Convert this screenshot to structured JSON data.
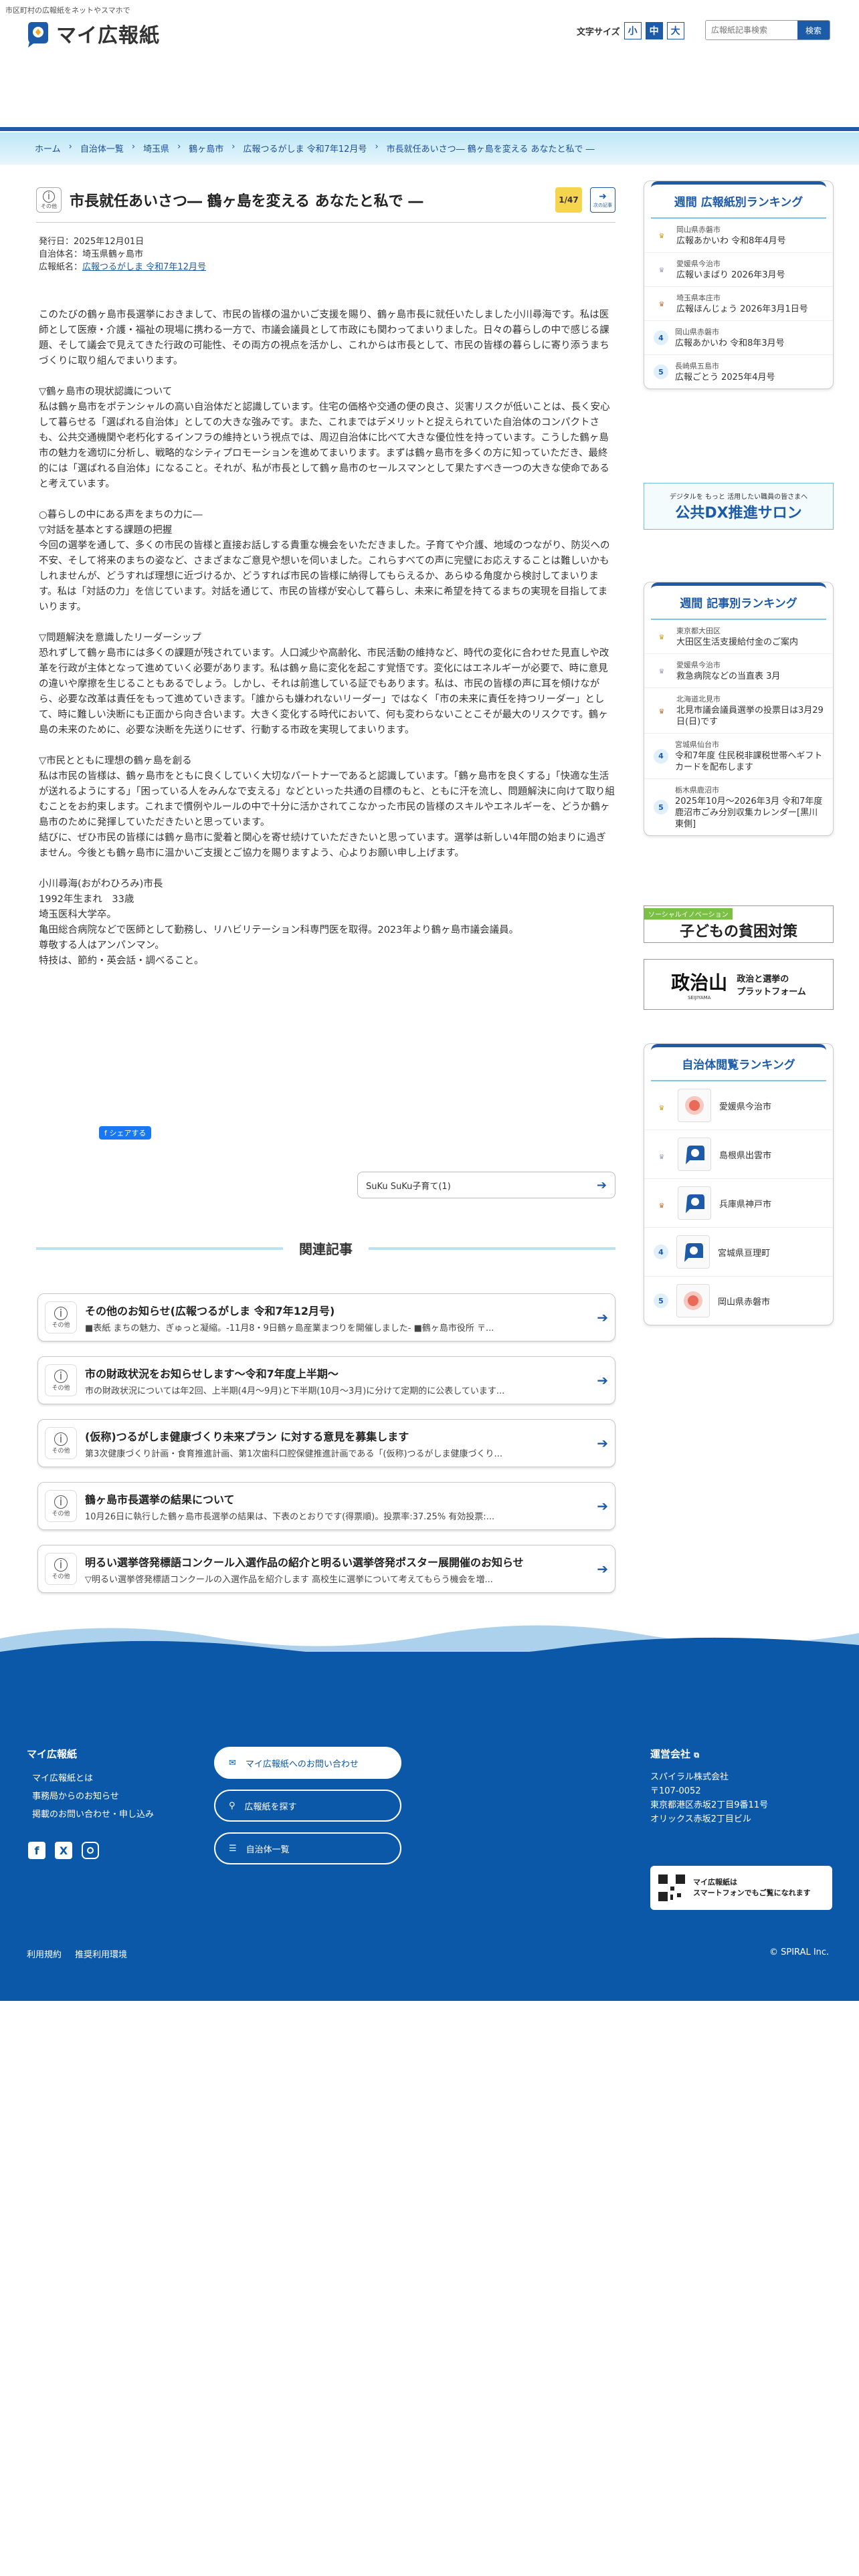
{
  "header": {
    "tagline": "市区町村の広報紙をネットやスマホで",
    "logo_text": "マイ広報紙",
    "font_size_label": "文字サイズ",
    "font_sizes": [
      "小",
      "中",
      "大"
    ],
    "search_placeholder": "広報紙記事検索",
    "search_button": "検索"
  },
  "breadcrumb": [
    "ホーム",
    "自治体一覧",
    "埼玉県",
    "鶴ヶ島市",
    "広報つるがしま 令和7年12月号",
    "市長就任あいさつ― 鶴ヶ島を変える あなたと私で ―"
  ],
  "article": {
    "category": "その他",
    "title": "市長就任あいさつ― 鶴ヶ島を変える あなたと私で ―",
    "page_badge": "1/47",
    "next_label": "次の記事",
    "published": "発行日：2025年12月01日",
    "municipality": "自治体名：埼玉県鶴ヶ島市",
    "paper_label": "広報紙名：",
    "paper_name": "広報つるがしま 令和7年12月号",
    "body": "このたびの鶴ヶ島市長選挙におきまして、市民の皆様の温かいご支援を賜り、鶴ヶ島市長に就任いたしました小川尋海です。私は医師として医療・介護・福祉の現場に携わる一方で、市議会議員として市政にも関わってまいりました。日々の暮らしの中で感じる課題、そして議会で見えてきた行政の可能性、その両方の視点を活かし、これからは市長として、市民の皆様の暮らしに寄り添うまちづくりに取り組んでまいります。\n\n▽鶴ヶ島市の現状認識について\n私は鶴ヶ島市をポテンシャルの高い自治体だと認識しています。住宅の価格や交通の便の良さ、災害リスクが低いことは、長く安心して暮らせる「選ばれる自治体」としての大きな強みです。また、これまではデメリットと捉えられていた自治体のコンパクトさも、公共交通機関や老朽化するインフラの維持という視点では、周辺自治体に比べて大きな優位性を持っています。こうした鶴ヶ島市の魅力を適切に分析し、戦略的なシティプロモーションを進めてまいります。まずは鶴ヶ島市を多くの方に知っていただき、最終的には「選ばれる自治体」になること。それが、私が市長として鶴ヶ島市のセールスマンとして果たすべき一つの大きな使命であると考えています。\n\n○暮らしの中にある声をまちの力に―\n▽対話を基本とする課題の把握\n今回の選挙を通して、多くの市民の皆様と直接お話しする貴重な機会をいただきました。子育てや介護、地域のつながり、防災への不安、そして将来のまちの姿など、さまざまなご意見や想いを伺いました。これらすべての声に完璧にお応えすることは難しいかもしれませんが、どうすれば理想に近づけるか、どうすれば市民の皆様に納得してもらえるか、あらゆる角度から検討してまいります。私は「対話の力」を信じています。対話を通じて、市民の皆様が安心して暮らし、未来に希望を持てるまちの実現を目指してまいります。\n\n▽問題解決を意識したリーダーシップ\n恐れずして鶴ヶ島市には多くの課題が残されています。人口減少や高齢化、市民活動の維持など、時代の変化に合わせた見直しや改革を行政が主体となって進めていく必要があります。私は鶴ヶ島に変化を起こす覚悟です。変化にはエネルギーが必要で、時に意見の違いや摩擦を生じることもあるでしょう。しかし、それは前進している証でもあります。私は、市民の皆様の声に耳を傾けながら、必要な改革は責任をもって進めていきます。「誰からも嫌われないリーダー」ではなく「市の未来に責任を持つリーダー」として、時に難しい決断にも正面から向き合います。大きく変化する時代において、何も変わらないことこそが最大のリスクです。鶴ヶ島の未来のために、必要な決断を先送りにせず、行動する市政を実現してまいります。\n\n▽市民とともに理想の鶴ヶ島を創る\n私は市民の皆様は、鶴ヶ島市をともに良くしていく大切なパートナーであると認識しています。「鶴ヶ島市を良くする」「快適な生活が送れるようにする」「困っている人をみんなで支える」などといった共通の目標のもと、ともに汗を流し、問題解決に向けて取り組むことをお約束します。これまで慣例やルールの中で十分に活かされてこなかった市民の皆様のスキルやエネルギーを、どうか鶴ヶ島市のために発揮していただきたいと思っています。\n結びに、ぜひ市民の皆様には鶴ヶ島市に愛着と関心を寄せ続けていただきたいと思っています。選挙は新しい4年間の始まりに過ぎません。今後とも鶴ヶ島市に温かいご支援とご協力を賜りますよう、心よりお願い申し上げます。\n\n小川尋海(おがわひろみ)市長\n1992年生まれ　33歳\n埼玉医科大学卒。\n亀田総合病院などで医師として勤務し、リハビリテーション科専門医を取得。2023年より鶴ヶ島市議会議員。\n尊敬する人はアンパンマン。\n特技は、節約・英会話・調べること。",
    "share_label": "シェアする",
    "next_article": "SuKu SuKu子育て(1)"
  },
  "related": {
    "title": "関連記事",
    "category": "その他",
    "items": [
      {
        "title": "その他のお知らせ(広報つるがしま 令和7年12月号)",
        "excerpt": "■表紙 まちの魅力、ぎゅっと凝縮。-11月8・9日鶴ヶ島産業まつりを開催しました- ■鶴ヶ島市役所 〒..."
      },
      {
        "title": "市の財政状況をお知らせします〜令和7年度上半期〜",
        "excerpt": "市の財政状況については年2回、上半期(4月〜9月)と下半期(10月〜3月)に分けて定期的に公表しています..."
      },
      {
        "title": "(仮称)つるがしま健康づくり未来プラン に対する意見を募集します",
        "excerpt": "第3次健康づくり計画・食育推進計画、第1次歯科口腔保健推進計画である「(仮称)つるがしま健康づくり..."
      },
      {
        "title": "鶴ヶ島市長選挙の結果について",
        "excerpt": "10月26日に執行した鶴ヶ島市長選挙の結果は、下表のとおりです(得票順)。投票率:37.25% 有効投票:..."
      },
      {
        "title": "明るい選挙啓発標語コンクール入選作品の紹介と明るい選挙啓発ポスター展開催のお知らせ",
        "excerpt": "▽明るい選挙啓発標語コンクールの入選作品を紹介します 高校生に選挙について考えてもらう機会を増..."
      }
    ]
  },
  "sidebar": {
    "weekly_paper_title": "週間 広報紙別ランキング",
    "weekly_paper": [
      {
        "rank": "1",
        "muni": "岡山県赤磐市",
        "name": "広報あかいわ 令和8年4月号"
      },
      {
        "rank": "2",
        "muni": "愛媛県今治市",
        "name": "広報いまばり 2026年3月号"
      },
      {
        "rank": "3",
        "muni": "埼玉県本庄市",
        "name": "広報ほんじょう 2026年3月1日号"
      },
      {
        "rank": "4",
        "muni": "岡山県赤磐市",
        "name": "広報あかいわ 令和8年3月号"
      },
      {
        "rank": "5",
        "muni": "長崎県五島市",
        "name": "広報ごとう 2025年4月号"
      }
    ],
    "dx_banner_sub": "デジタルを もっと 活用したい職員の皆さまへ",
    "dx_banner": "公共DX推進サロン",
    "weekly_article_title": "週間 記事別ランキング",
    "weekly_article": [
      {
        "rank": "1",
        "muni": "東京都大田区",
        "name": "大田区生活支援給付金のご案内"
      },
      {
        "rank": "2",
        "muni": "愛媛県今治市",
        "name": "救急病院などの当直表 3月"
      },
      {
        "rank": "3",
        "muni": "北海道北見市",
        "name": "北見市議会議員選挙の投票日は3月29日(日)です"
      },
      {
        "rank": "4",
        "muni": "宮城県仙台市",
        "name": "令和7年度 住民税非課税世帯へギフトカードを配布します"
      },
      {
        "rank": "5",
        "muni": "栃木県鹿沼市",
        "name": "2025年10月〜2026年3月 令和7年度 鹿沼市ごみ分別収集カレンダー[黒川東側]"
      }
    ],
    "social_banner_tag": "ソーシャルイノベーション",
    "social_banner": "子どもの貧困対策",
    "politics_logo": "政治山",
    "politics_sub": "SEIJIYAMA",
    "politics_text": "政治と選挙の\nプラットフォーム",
    "muni_title": "自治体閲覧ランキング",
    "muni_rank": [
      {
        "rank": "1",
        "name": "愛媛県今治市"
      },
      {
        "rank": "2",
        "name": "島根県出雲市"
      },
      {
        "rank": "3",
        "name": "兵庫県神戸市"
      },
      {
        "rank": "4",
        "name": "宮城県亘理町"
      },
      {
        "rank": "5",
        "name": "岡山県赤磐市"
      }
    ]
  },
  "footer": {
    "brand": "マイ広報紙",
    "links": [
      "マイ広報紙とは",
      "事務局からのお知らせ",
      "掲載のお問い合わせ・申し込み"
    ],
    "contact_button": "マイ広報紙へのお問い合わせ",
    "search_button": "広報紙を探す",
    "list_button": "自治体一覧",
    "company_title": "運営会社",
    "company_lines": [
      "スパイラル株式会社",
      "〒107-0052",
      "東京都港区赤坂2丁目9番11号",
      "オリックス赤坂2丁目ビル"
    ],
    "qr_title": "マイ広報紙は",
    "qr_text": "スマートフォンでもご覧になれます",
    "bottom_links": [
      "利用規約",
      "推奨利用環境"
    ],
    "copyright": "© SPIRAL Inc."
  },
  "colors": {
    "primary": "#1d5aa8",
    "footer": "#0b57a8",
    "light_band": "#bde7f6",
    "badge": "#f5d44e"
  }
}
